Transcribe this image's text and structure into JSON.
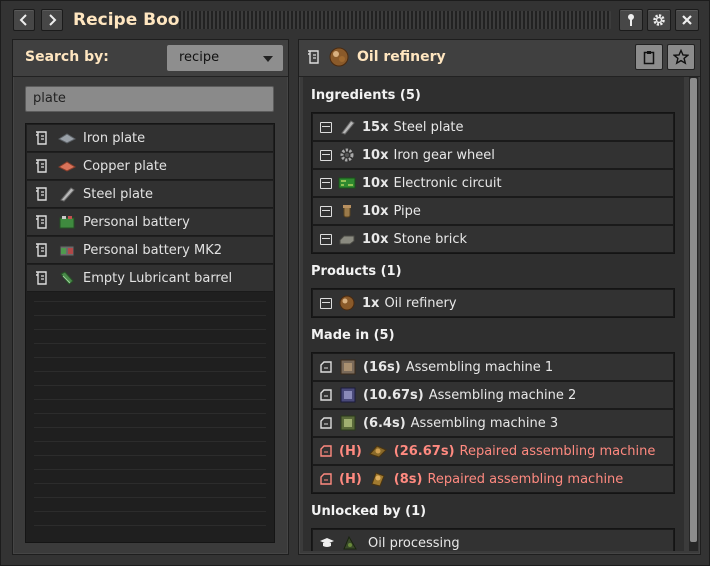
{
  "window": {
    "title": "Recipe Book"
  },
  "left": {
    "search_by_label": "Search by:",
    "search_by_value": "recipe",
    "search_text": "plate",
    "results": [
      {
        "label": "Iron plate",
        "icon": "iron-plate"
      },
      {
        "label": "Copper plate",
        "icon": "copper-plate"
      },
      {
        "label": "Steel plate",
        "icon": "steel-plate"
      },
      {
        "label": "Personal battery",
        "icon": "personal-battery"
      },
      {
        "label": "Personal battery MK2",
        "icon": "personal-battery-mk2"
      },
      {
        "label": "Empty Lubricant barrel",
        "icon": "lubricant-barrel"
      }
    ]
  },
  "right": {
    "title": "Oil refinery",
    "ingredients_title": "Ingredients (5)",
    "ingredients": [
      {
        "qty": "15x",
        "label": "Steel plate"
      },
      {
        "qty": "10x",
        "label": "Iron gear wheel"
      },
      {
        "qty": "10x",
        "label": "Electronic circuit"
      },
      {
        "qty": "10x",
        "label": "Pipe"
      },
      {
        "qty": "10x",
        "label": "Stone brick"
      }
    ],
    "products_title": "Products (1)",
    "products": [
      {
        "qty": "1x",
        "label": "Oil refinery"
      }
    ],
    "made_in_title": "Made in (5)",
    "made_in": [
      {
        "prefix": "",
        "time": "(16s)",
        "label": "Assembling machine 1",
        "hidden": false
      },
      {
        "prefix": "",
        "time": "(10.67s)",
        "label": "Assembling machine 2",
        "hidden": false
      },
      {
        "prefix": "",
        "time": "(6.4s)",
        "label": "Assembling machine 3",
        "hidden": false
      },
      {
        "prefix": "(H)",
        "time": "(26.67s)",
        "label": "Repaired assembling machine",
        "hidden": true
      },
      {
        "prefix": "(H)",
        "time": "(8s)",
        "label": "Repaired assembling machine",
        "hidden": true
      }
    ],
    "unlocked_title": "Unlocked by (1)",
    "unlocked": [
      {
        "label": "Oil processing"
      }
    ]
  },
  "colors": {
    "title": "#ffe6c0",
    "hidden_text": "#ff8a80"
  }
}
